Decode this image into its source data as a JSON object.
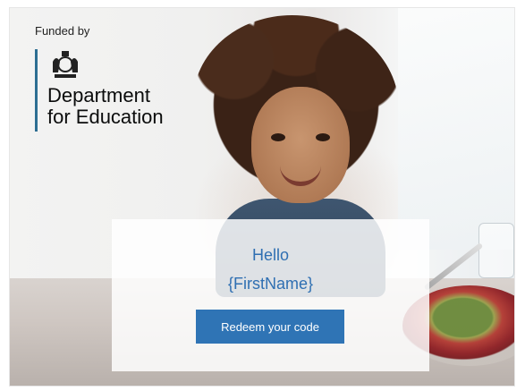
{
  "branding": {
    "funded_by": "Funded by",
    "department_line1": "Department",
    "department_line2": "for Education",
    "crest_icon": "royal-coat-of-arms-icon",
    "accent_line_color": "#2d6e92"
  },
  "card": {
    "greeting": "Hello",
    "first_name_placeholder": "{FirstName}",
    "redeem_button_label": "Redeem your code",
    "text_color": "#2f6fb2",
    "button_color": "#2f74b5"
  }
}
